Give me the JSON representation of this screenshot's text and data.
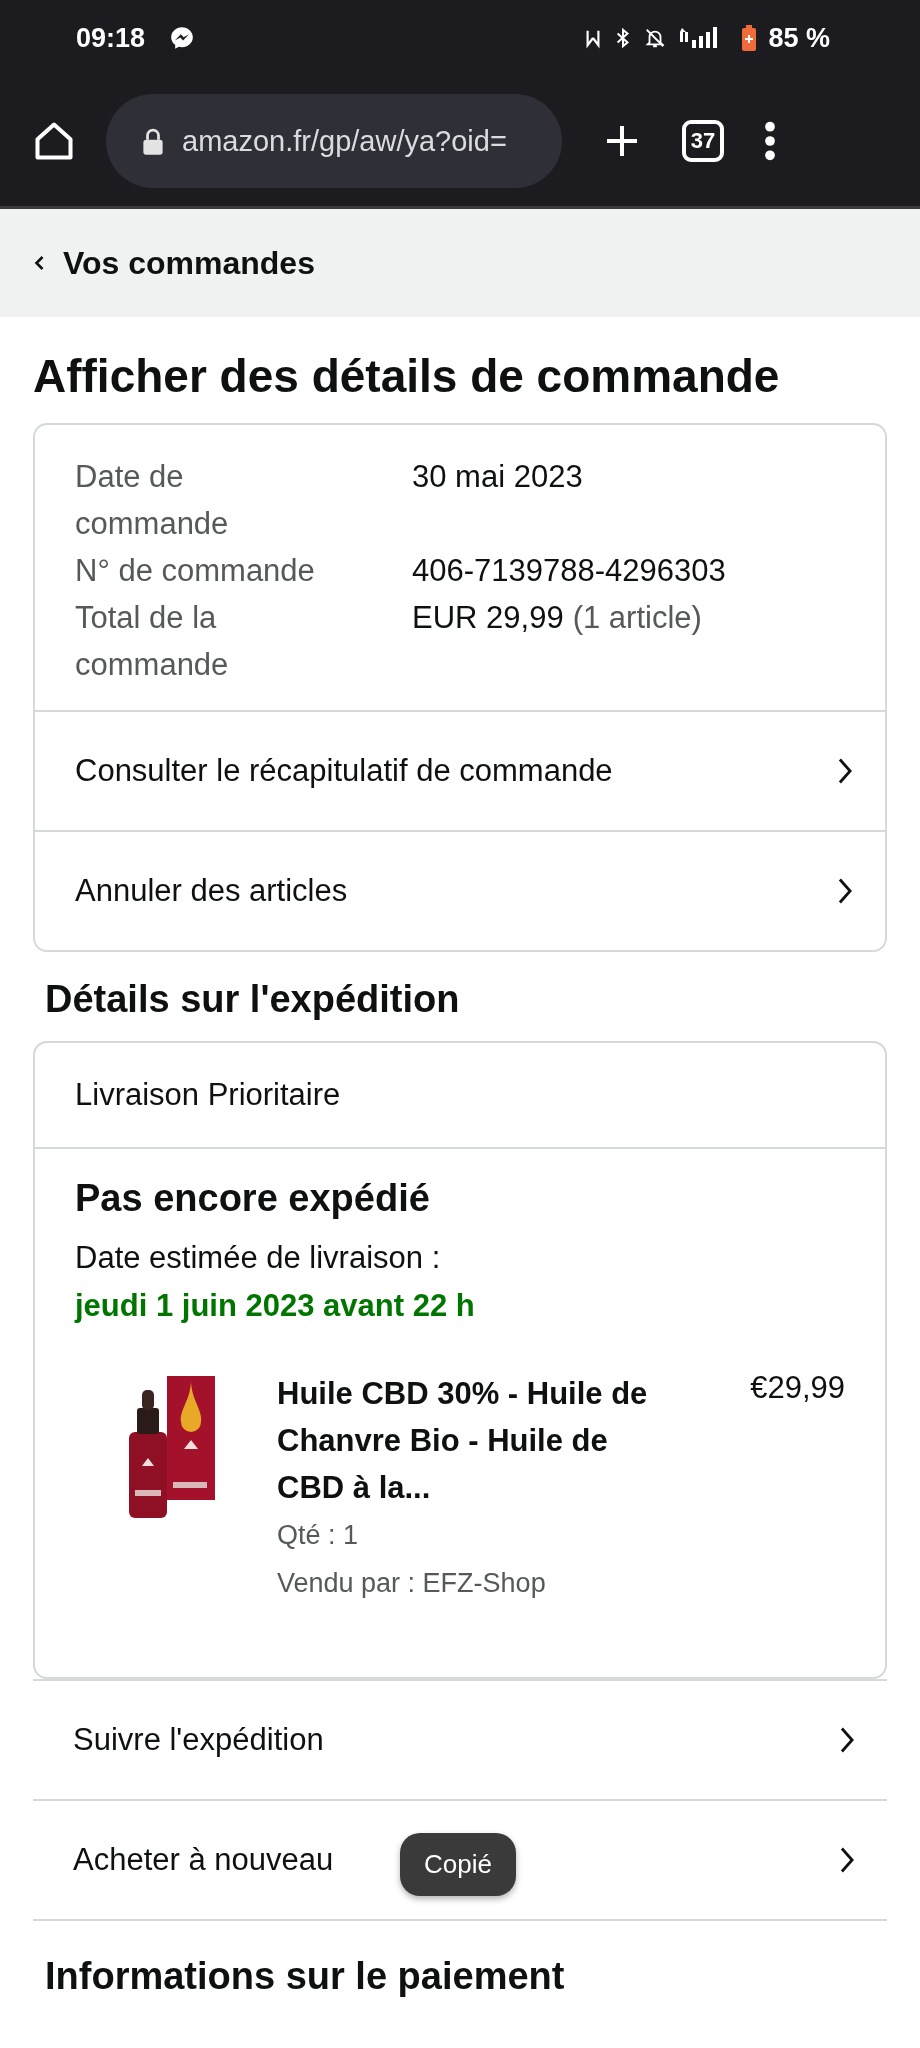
{
  "status_bar": {
    "time": "09:18",
    "battery": "85 %"
  },
  "browser": {
    "url": "amazon.fr/gp/aw/ya?oid=",
    "tab_count": "37"
  },
  "breadcrumb": {
    "back_label": "Vos commandes"
  },
  "page_title": "Afficher des détails de commande",
  "summary": {
    "fields": [
      {
        "label": "Date de commande",
        "value": "30 mai 2023"
      },
      {
        "label": "N° de commande",
        "value": "406-7139788-4296303"
      },
      {
        "label": "Total de la commande",
        "value": "EUR 29,99",
        "note": "(1 article)"
      }
    ],
    "links": [
      "Consulter le récapitulatif de commande",
      "Annuler des articles"
    ]
  },
  "shipment": {
    "heading": "Détails sur l'expédition",
    "method": "Livraison Prioritaire",
    "status": "Pas encore expédié",
    "eta_label": "Date estimée de livraison :",
    "eta": "jeudi 1 juin 2023 avant 22 h",
    "item": {
      "kind": "picture",
      "title": "Huile CBD 30% - Huile de Chanvre Bio - Huile de CBD à la...",
      "price": "€29,99",
      "quantity": "Qté : 1",
      "seller": "Vendu par : EFZ-Shop"
    },
    "actions": [
      "Suivre l'expédition",
      "Acheter à nouveau"
    ]
  },
  "payment": {
    "heading": "Informations sur le paiement"
  },
  "toast": "Copié"
}
